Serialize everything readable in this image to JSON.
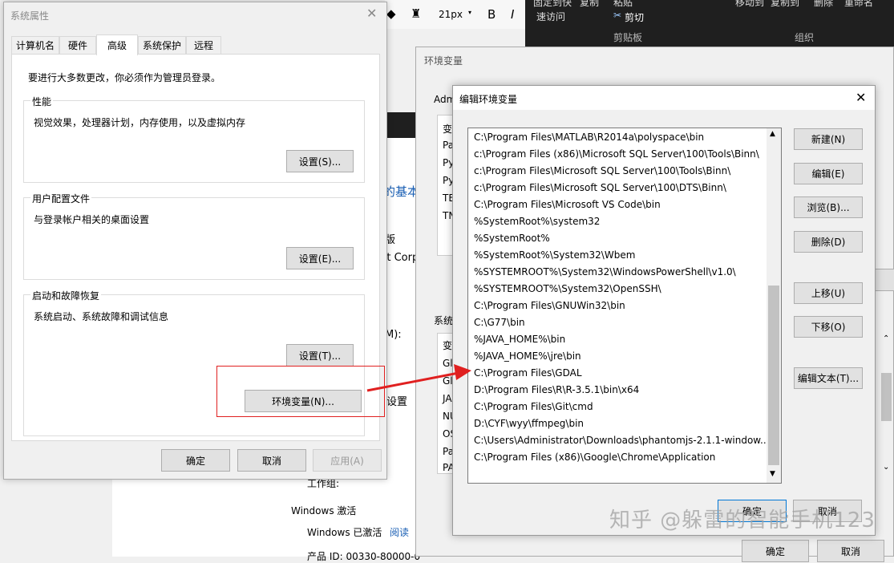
{
  "top_toolbar": {
    "font_size": "21px",
    "bold": "B",
    "italic": "I",
    "clipboard_items": [
      "固定到快",
      "速访问",
      "复制",
      "粘贴",
      "剪切"
    ],
    "clipboard_label": "剪贴板",
    "organize_items": [
      "移动到",
      "复制到",
      "删除",
      "重命名"
    ],
    "organize_label": "组织"
  },
  "sys_props": {
    "title": "系统属性",
    "tabs": [
      "计算机名",
      "硬件",
      "高级",
      "系统保护",
      "远程"
    ],
    "admin_note": "要进行大多数更改，你必须作为管理员登录。",
    "performance": {
      "title": "性能",
      "desc": "视觉效果，处理器计划，内存使用，以及虚拟内存",
      "button": "设置(S)..."
    },
    "profiles": {
      "title": "用户配置文件",
      "desc": "与登录帐户相关的桌面设置",
      "button": "设置(E)..."
    },
    "startup": {
      "title": "启动和故障恢复",
      "desc": "系统启动、系统故障和调试信息",
      "button": "设置(T)..."
    },
    "env_button": "环境变量(N)...",
    "ok": "确定",
    "cancel": "取消",
    "apply": "应用(A)"
  },
  "background": {
    "tab_label": "统",
    "basic_info": "的基本",
    "edition": "版",
    "corp": "ft Corp",
    "m_label": "M):",
    "settings": "设置",
    "workgroup": "工作组:",
    "win_activation": "Windows 激活",
    "activated": "Windows 已激活",
    "read": "阅读",
    "product_id": "产品 ID: 00330-80000-0"
  },
  "env_vars": {
    "title": "环境变量",
    "user_label": "Adm",
    "user_rows": [
      "变",
      "Pa",
      "Py",
      "Py",
      "TE",
      "TN"
    ],
    "sys_label": "系统",
    "sys_rows": [
      "变",
      "Gl",
      "Gl",
      "JA",
      "NU",
      "OS",
      "Pa",
      "PA"
    ],
    "ok": "确定",
    "cancel": "取消"
  },
  "edit_env": {
    "title": "编辑环境变量",
    "paths": [
      "C:\\Program Files\\MATLAB\\R2014a\\polyspace\\bin",
      "c:\\Program Files (x86)\\Microsoft SQL Server\\100\\Tools\\Binn\\",
      "c:\\Program Files\\Microsoft SQL Server\\100\\Tools\\Binn\\",
      "c:\\Program Files\\Microsoft SQL Server\\100\\DTS\\Binn\\",
      "C:\\Program Files\\Microsoft VS Code\\bin",
      "%SystemRoot%\\system32",
      "%SystemRoot%",
      "%SystemRoot%\\System32\\Wbem",
      "%SYSTEMROOT%\\System32\\WindowsPowerShell\\v1.0\\",
      "%SYSTEMROOT%\\System32\\OpenSSH\\",
      "C:\\Program Files\\GNUWin32\\bin",
      "C:\\G77\\bin",
      "%JAVA_HOME%\\bin",
      "%JAVA_HOME%\\jre\\bin",
      "C:\\Program Files\\GDAL",
      "D:\\Program Files\\R\\R-3.5.1\\bin\\x64",
      "C:\\Program Files\\Git\\cmd",
      "D:\\CYF\\wyy\\ffmpeg\\bin",
      "C:\\Users\\Administrator\\Downloads\\phantomjs-2.1.1-window...",
      "C:\\Program Files (x86)\\Google\\Chrome\\Application"
    ],
    "buttons": {
      "new": "新建(N)",
      "edit": "编辑(E)",
      "browse": "浏览(B)...",
      "delete": "删除(D)",
      "move_up": "上移(U)",
      "move_down": "下移(O)",
      "edit_text": "编辑文本(T)..."
    },
    "ok": "确定",
    "cancel": "取消"
  },
  "watermark": "知乎 @躲雷的智能手机123",
  "colors": {
    "highlight": "#e02020",
    "accent": "#0078d7",
    "toolbar_dark": "#1f1f1f"
  }
}
